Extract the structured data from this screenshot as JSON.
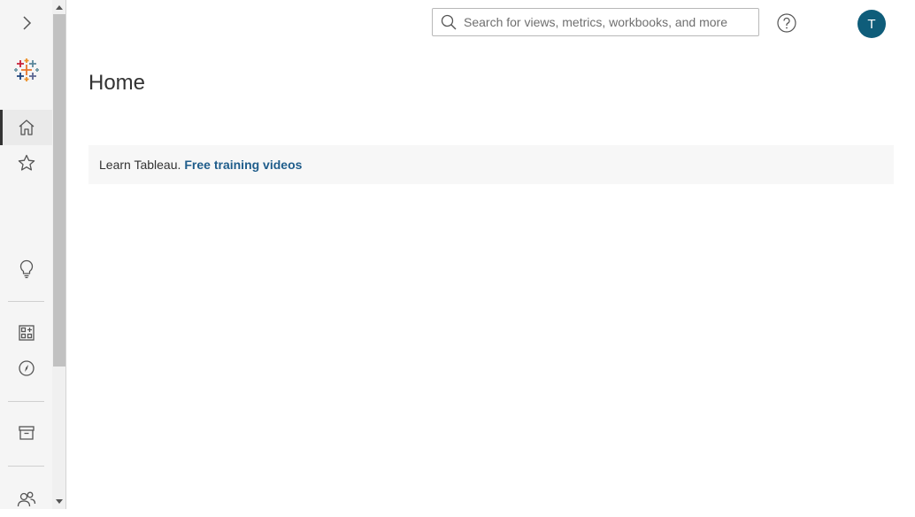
{
  "sidebar": {
    "expand_icon": "chevron-right-icon",
    "logo_icon": "tableau-logo-icon",
    "items": [
      {
        "name": "home",
        "icon": "home-icon",
        "active": true
      },
      {
        "name": "favorites",
        "icon": "star-icon",
        "active": false
      },
      {
        "name": "recommendations",
        "icon": "lightbulb-icon",
        "active": false
      },
      {
        "name": "collections",
        "icon": "collections-icon",
        "active": false
      },
      {
        "name": "explore",
        "icon": "compass-icon",
        "active": false
      },
      {
        "name": "external-assets",
        "icon": "archive-box-icon",
        "active": false
      },
      {
        "name": "users",
        "icon": "users-icon",
        "active": false
      }
    ]
  },
  "header": {
    "search_placeholder": "Search for views, metrics, workbooks, and more",
    "help_icon": "help-icon",
    "avatar_initial": "T",
    "avatar_color": "#0f5d7a"
  },
  "main": {
    "title": "Home",
    "banner": {
      "lead_text": "Learn Tableau.",
      "link_text": "Free training videos",
      "link_color": "#1f5d8b"
    }
  }
}
